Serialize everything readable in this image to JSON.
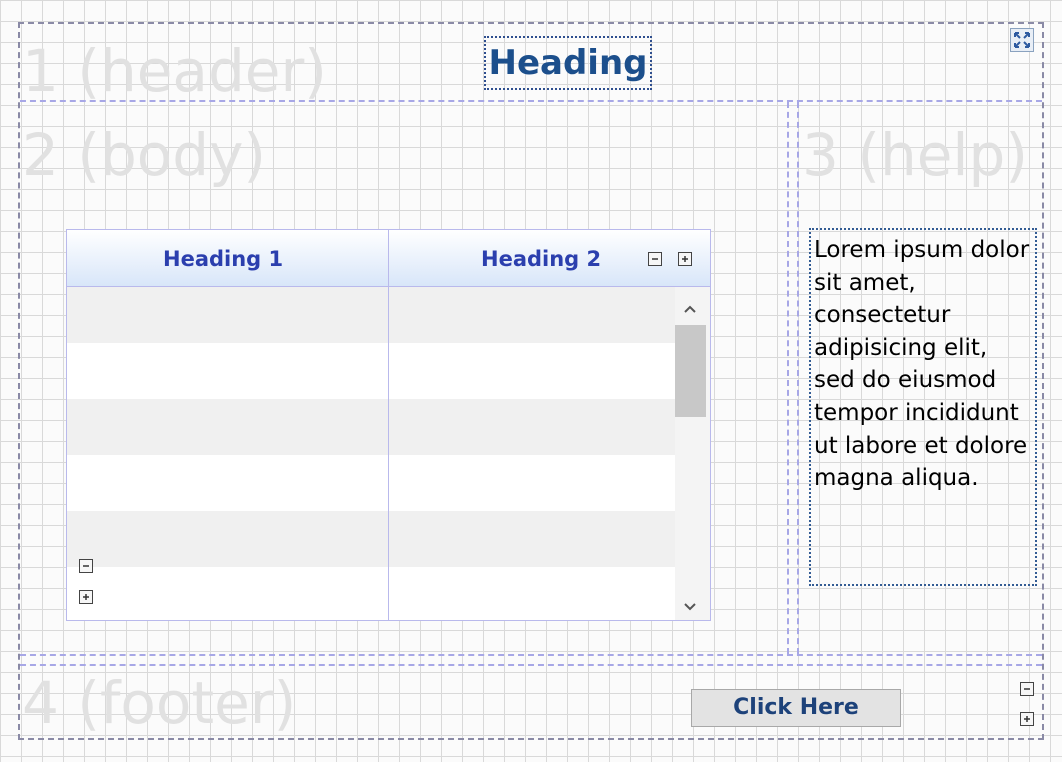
{
  "regions": {
    "header_watermark": "1 (header)",
    "body_watermark": "2 (body)",
    "help_watermark": "3 (help)",
    "footer_watermark": "4 (footer)"
  },
  "heading": "Heading",
  "table": {
    "columns": [
      "Heading 1",
      "Heading 2"
    ],
    "rows": [
      {
        "c1": "",
        "c2": ""
      },
      {
        "c1": "",
        "c2": ""
      },
      {
        "c1": "",
        "c2": ""
      },
      {
        "c1": "",
        "c2": ""
      },
      {
        "c1": "",
        "c2": ""
      },
      {
        "c1": "",
        "c2": ""
      }
    ],
    "scroll_up": "⌃",
    "scroll_down": "⌄"
  },
  "help": {
    "text": "Lorem ipsum dolor sit amet, consectetur adipisicing elit, sed do eiusmod tempor incididunt ut labore et dolore magna aliqua."
  },
  "footer": {
    "button_label": "Click Here"
  },
  "icons": {
    "expand": "expand-icon",
    "collapse": "minus-box-icon",
    "add": "plus-box-icon"
  }
}
